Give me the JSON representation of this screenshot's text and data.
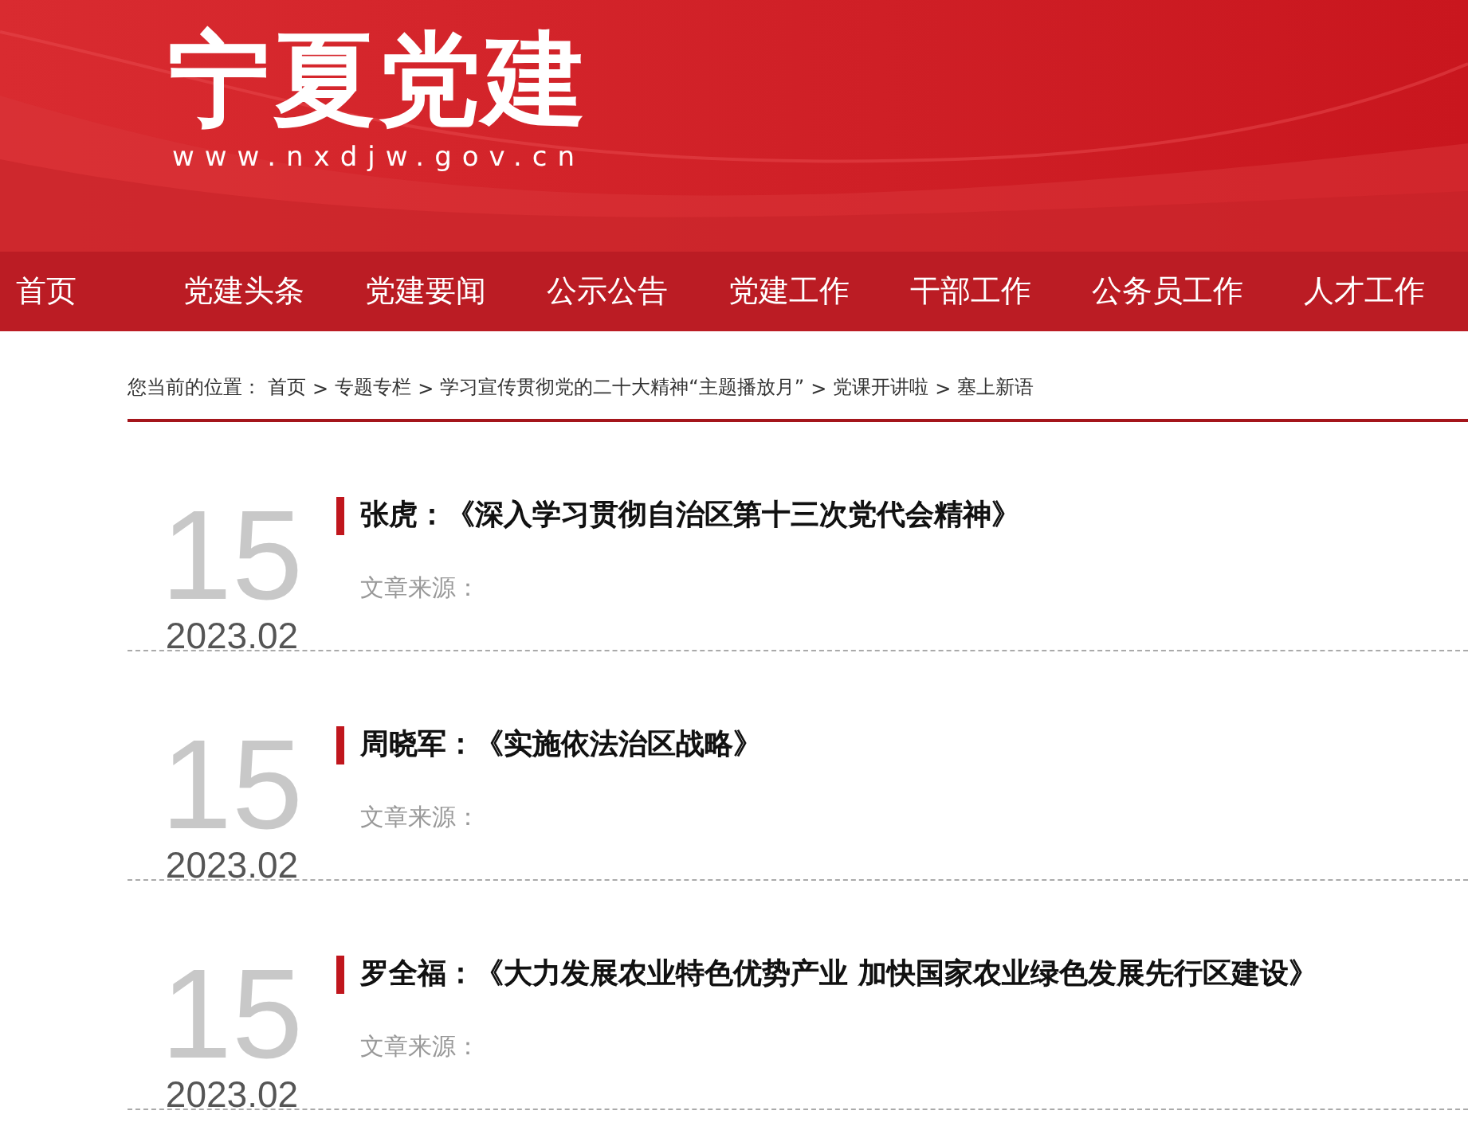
{
  "header": {
    "logo": "宁夏党建",
    "url": "www.nxdjw.gov.cn"
  },
  "nav": [
    {
      "label": "首页",
      "selected": false
    },
    {
      "label": "党建头条",
      "selected": false
    },
    {
      "label": "党建要闻",
      "selected": false
    },
    {
      "label": "公示公告",
      "selected": false
    },
    {
      "label": "党建工作",
      "selected": false
    },
    {
      "label": "干部工作",
      "selected": false
    },
    {
      "label": "公务员工作",
      "selected": false
    },
    {
      "label": "人才工作",
      "selected": false
    }
  ],
  "breadcrumb": {
    "label": "您当前的位置：",
    "separator": ">",
    "items": [
      "首页",
      "专题专栏",
      "学习宣传贯彻党的二十大精神“主题播放月”",
      "党课开讲啦",
      "塞上新语"
    ]
  },
  "articles": [
    {
      "day": "15",
      "month": "2023.02",
      "title": "张虎：《深入学习贯彻自治区第十三次党代会精神》",
      "source": "文章来源："
    },
    {
      "day": "15",
      "month": "2023.02",
      "title": "周晓军：《实施依法治区战略》",
      "source": "文章来源："
    },
    {
      "day": "15",
      "month": "2023.02",
      "title": "罗全福：《大力发展农业特色优势产业 加快国家农业绿色发展先行区建设》",
      "source": "文章来源："
    }
  ]
}
